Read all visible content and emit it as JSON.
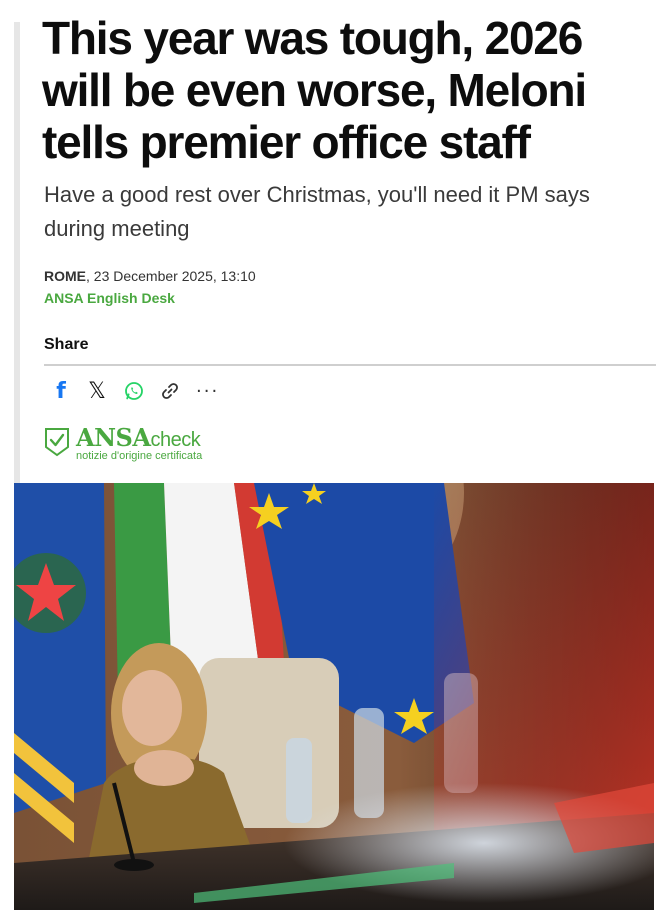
{
  "article": {
    "headline": "This year was tough, 2026 will be even worse, Meloni tells premier office staff",
    "subtitle": "Have a good rest over Christmas, you'll need it PM says during meeting",
    "city": "ROME",
    "dateline": ", 23 December 2025, 13:10",
    "desk": "ANSA English Desk"
  },
  "share": {
    "label": "Share",
    "icons": [
      "facebook-icon",
      "x-icon",
      "whatsapp-icon",
      "link-icon",
      "more-icon"
    ]
  },
  "ansacheck": {
    "brand": "ANSA",
    "check": "check",
    "tagline": "notizie d'origine certificata"
  },
  "colors": {
    "accent_green": "#4aa840",
    "facebook_blue": "#1877f2",
    "whatsapp_green": "#25d366"
  }
}
